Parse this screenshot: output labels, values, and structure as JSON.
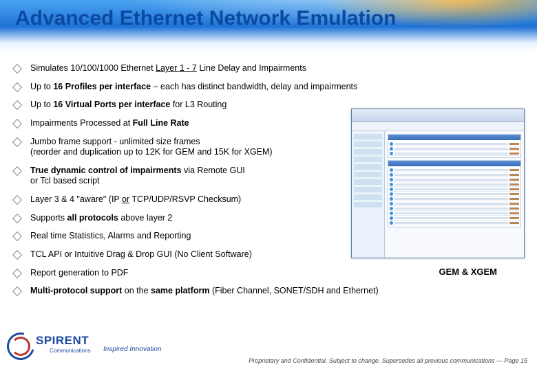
{
  "title": "Advanced Ethernet Network Emulation",
  "bullets": [
    "Simulates 10/100/1000 Ethernet <span class='u'>Layer 1 - 7</span> Line Delay and Impairments",
    "Up to <b>16 Profiles per interface</b> – each has distinct bandwidth, delay and impairments",
    "Up to <b>16 Virtual Ports per interface</b> for L3 Routing",
    "Impairments Processed at <b>Full Line Rate</b>",
    "Jumbo frame support - unlimited size frames<br>(reorder and duplication up to 12K for GEM and 15K for XGEM)",
    "<b>True dynamic control of impairments</b> via Remote GUI<br>or Tcl based script",
    "Layer 3 & 4 \"aware\" (IP <span class='u'>or</span> TCP/UDP/RSVP Checksum)",
    "Supports <b>all protocols</b> above layer 2",
    "Real time Statistics, Alarms and Reporting",
    "TCL API or Intuitive Drag & Drop GUI (No Client Software)",
    "Report generation to PDF",
    "<b>Multi-protocol support</b> on the <b>same platform</b> (Fiber Channel, SONET/SDH and Ethernet)"
  ],
  "caption": "GEM & XGEM",
  "logo": {
    "name": "SPIRENT",
    "sub": "Communications",
    "tagline": "Inspired Innovation"
  },
  "footer": "Proprietary and Confidential.  Subject to change.  Supersedes all previous communications — Page 15"
}
